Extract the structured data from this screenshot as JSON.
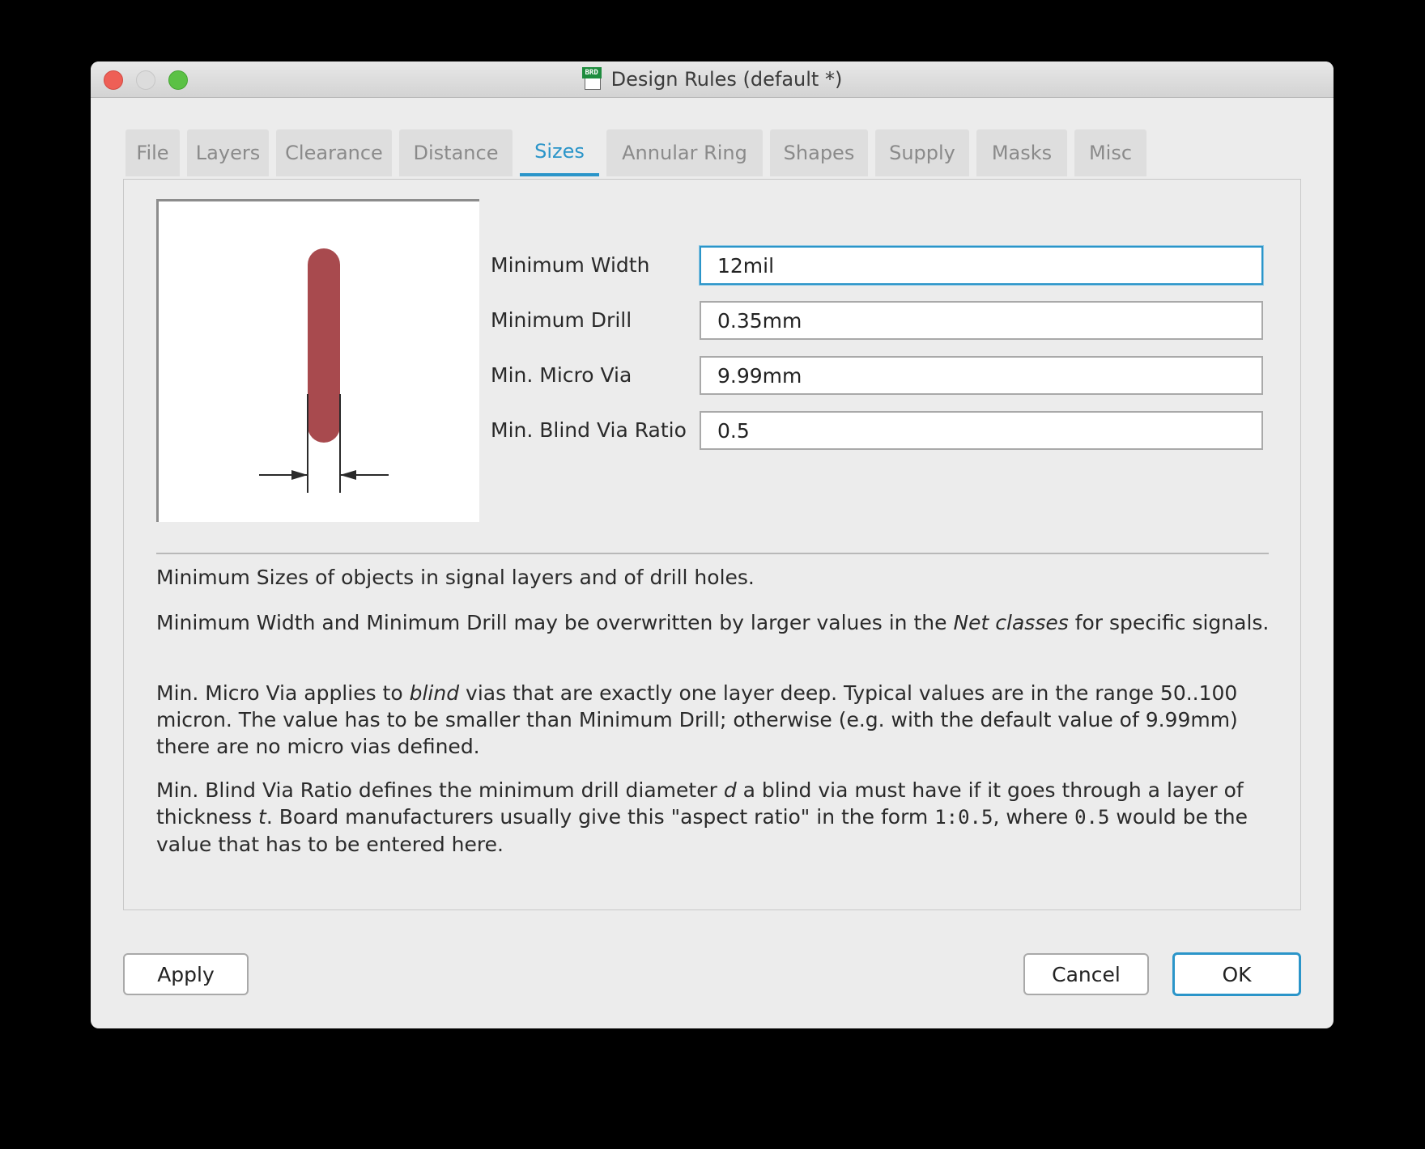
{
  "window": {
    "title": "Design Rules (default *)",
    "icon_badge": "BRD",
    "icon": "brd-document-icon"
  },
  "tabs": [
    {
      "label": "File",
      "active": false
    },
    {
      "label": "Layers",
      "active": false
    },
    {
      "label": "Clearance",
      "active": false
    },
    {
      "label": "Distance",
      "active": false
    },
    {
      "label": "Sizes",
      "active": true
    },
    {
      "label": "Annular Ring",
      "active": false
    },
    {
      "label": "Shapes",
      "active": false
    },
    {
      "label": "Supply",
      "active": false
    },
    {
      "label": "Masks",
      "active": false
    },
    {
      "label": "Misc",
      "active": false
    }
  ],
  "fields": {
    "min_width": {
      "label": "Minimum Width",
      "value": "12mil"
    },
    "min_drill": {
      "label": "Minimum Drill",
      "value": "0.35mm"
    },
    "min_micro_via": {
      "label": "Min. Micro Via",
      "value": "9.99mm"
    },
    "min_blind_via_ratio": {
      "label": "Min. Blind Via Ratio",
      "value": "0.5"
    }
  },
  "description": {
    "p1": "Minimum Sizes of objects in signal layers and of drill holes.",
    "p2_a": "Minimum Width and Minimum Drill may be overwritten by larger values in the ",
    "p2_em": "Net classes",
    "p2_b": " for specific signals.",
    "p3_a": "Min. Micro Via applies to ",
    "p3_em": "blind",
    "p3_b": " vias that are exactly one layer deep. Typical values are in the range 50..100 micron. The value has to be smaller than Minimum Drill; otherwise (e.g. with the default value of 9.99mm) there are no micro vias defined.",
    "p4_a": "Min. Blind Via Ratio defines the minimum drill diameter ",
    "p4_em1": "d",
    "p4_b": " a blind via must have if it goes through a layer of thickness ",
    "p4_em2": "t",
    "p4_c": ". Board manufacturers usually give this \"aspect ratio\" in the form ",
    "p4_code1": "1:0.5",
    "p4_d": ", where ",
    "p4_code2": "0.5",
    "p4_e": " would be the value that has to be entered here."
  },
  "buttons": {
    "apply": "Apply",
    "cancel": "Cancel",
    "ok": "OK"
  },
  "colors": {
    "accent": "#2b95c9",
    "trace": "#a84a4e",
    "close": "#ee5f56",
    "zoom": "#5bc145"
  }
}
